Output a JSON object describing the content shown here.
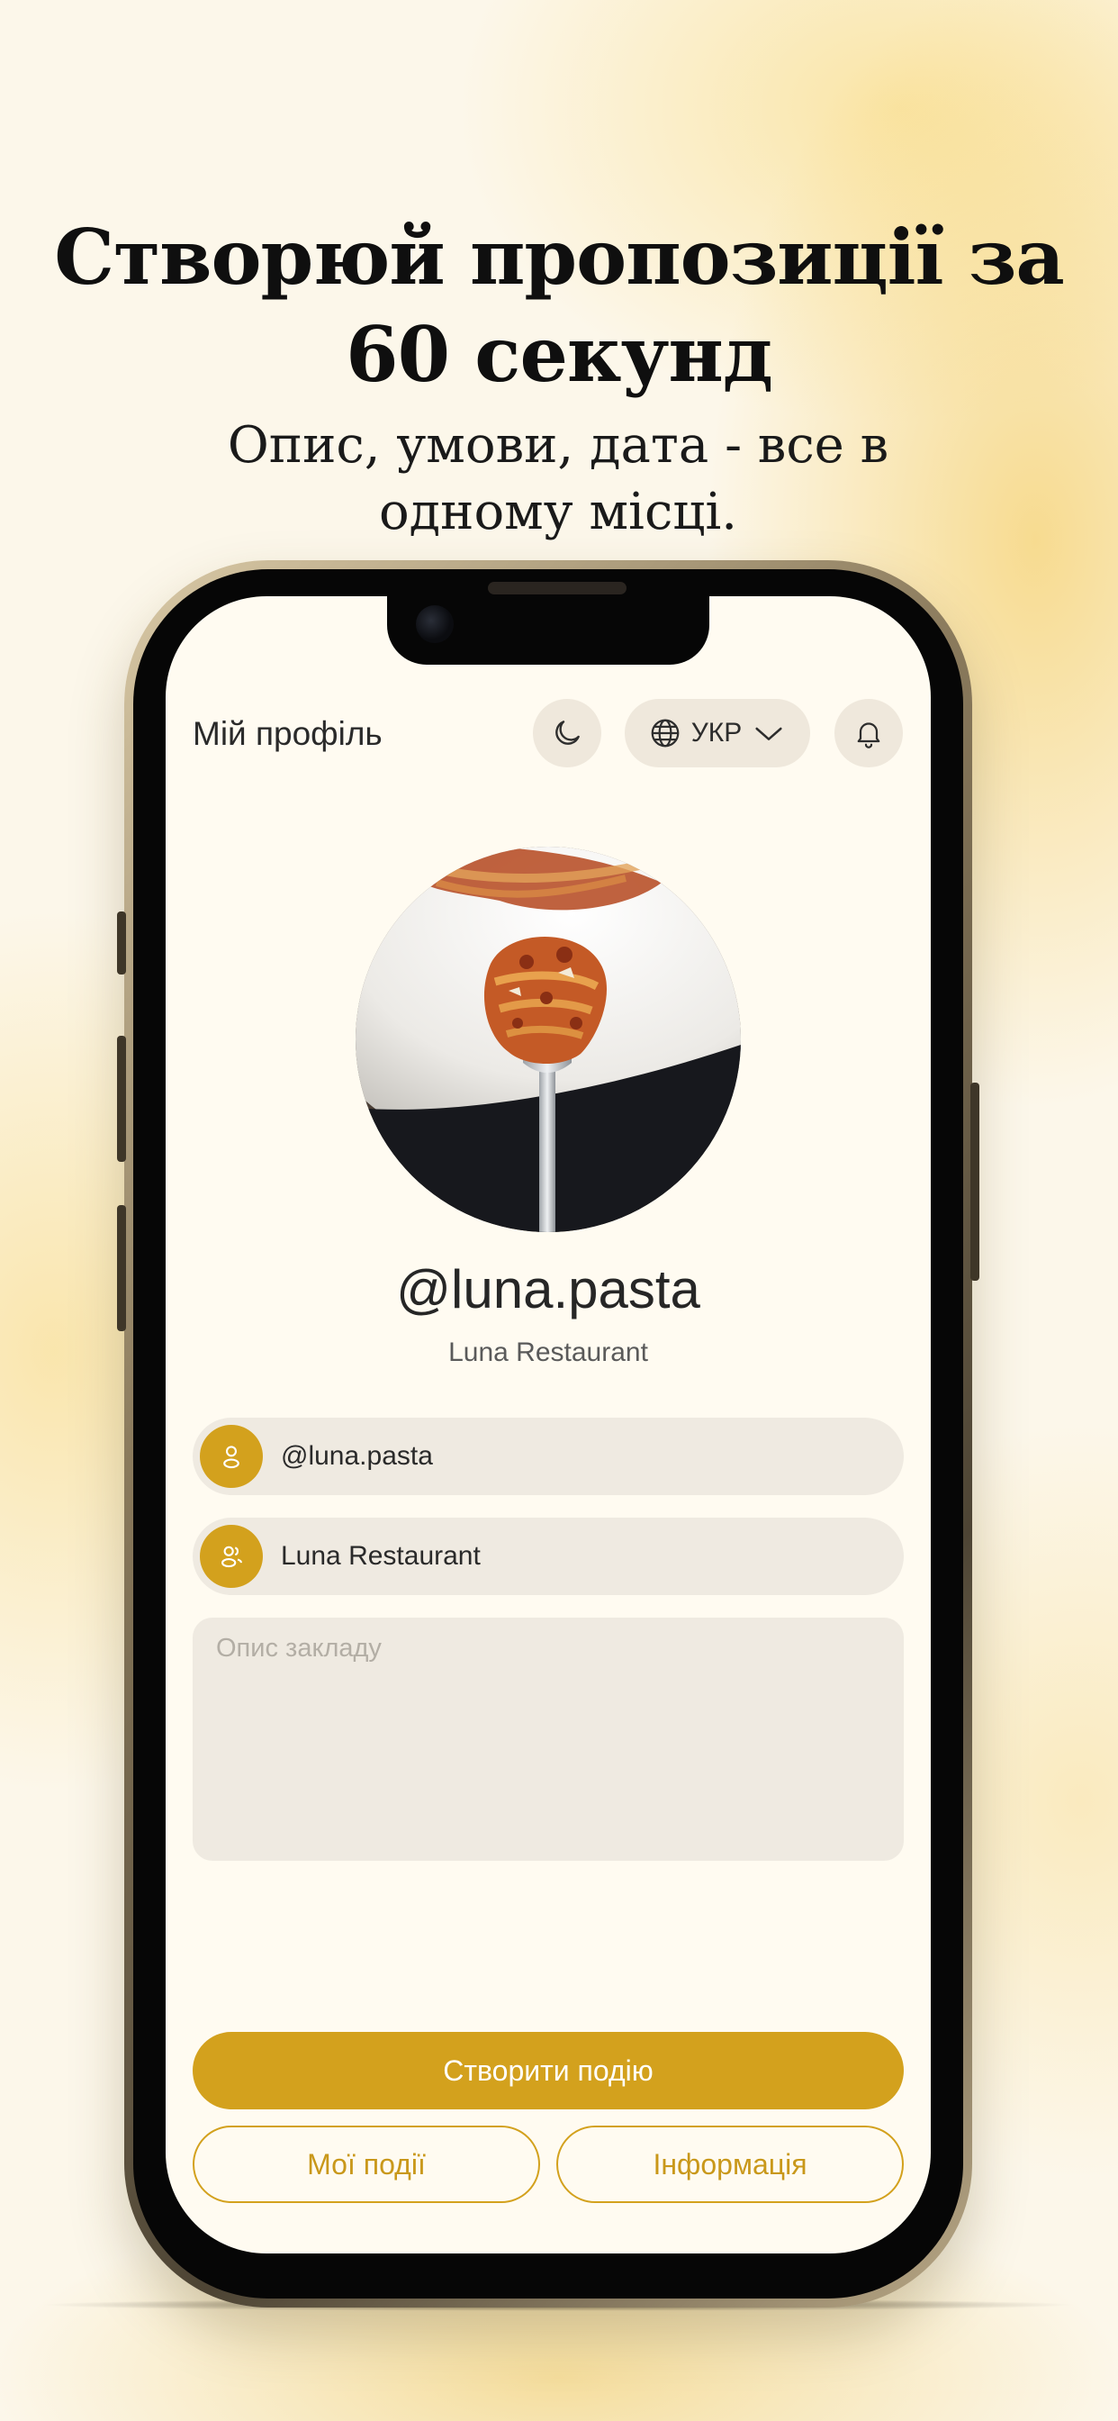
{
  "promo": {
    "title": "Створюй пропозиції за 60 секунд",
    "subtitle": "Опис, умови, дата - все в одному місці."
  },
  "header": {
    "title": "Мій профіль",
    "language": "УКР",
    "theme_icon": "moon-icon",
    "language_icon": "globe-icon",
    "dropdown_icon": "chevron-down-icon",
    "notification_icon": "bell-icon"
  },
  "profile": {
    "avatar": "pasta-on-fork-photo",
    "username": "@luna.pasta",
    "display_name": "Luna Restaurant"
  },
  "form": {
    "username_value": "@luna.pasta",
    "username_icon": "user-icon",
    "name_value": "Luna Restaurant",
    "name_icon": "users-icon",
    "description_placeholder": "Опис закладу",
    "description_value": ""
  },
  "actions": {
    "create_event": "Створити подію",
    "my_events": "Мої події",
    "info": "Інформація"
  },
  "colors": {
    "accent": "#d3a11d",
    "field_bg": "#efeae1",
    "screen_bg": "#fffbf1",
    "text": "#2a2a2a"
  }
}
